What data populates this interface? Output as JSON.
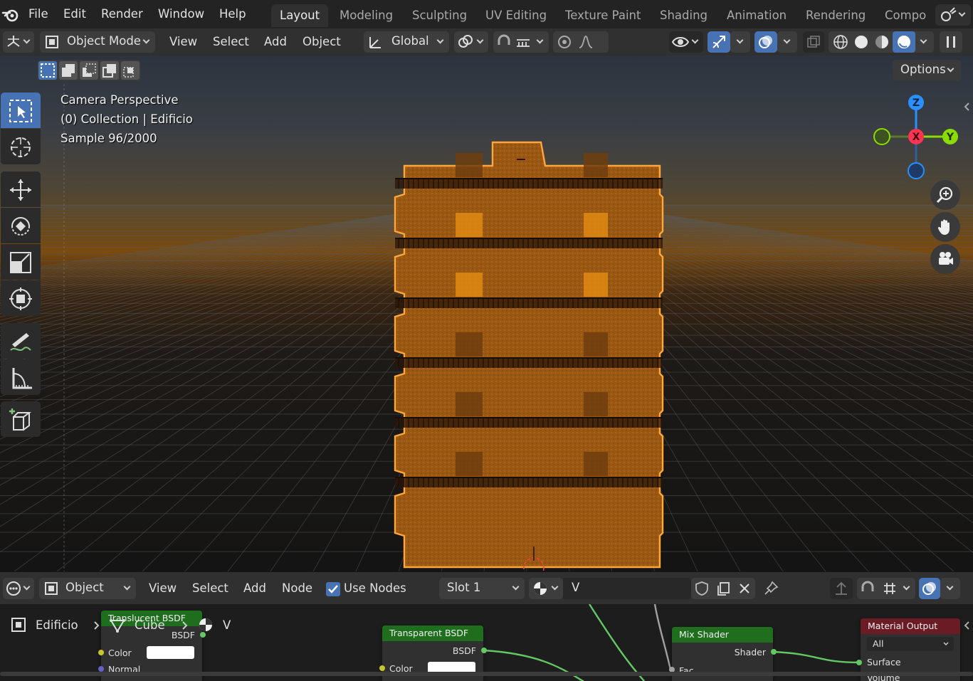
{
  "menu": {
    "items": [
      "File",
      "Edit",
      "Render",
      "Window",
      "Help"
    ]
  },
  "workspaces": {
    "tabs": [
      "Layout",
      "Modeling",
      "Sculpting",
      "UV Editing",
      "Texture Paint",
      "Shading",
      "Animation",
      "Rendering",
      "Compo"
    ],
    "active": "Layout"
  },
  "viewport_header": {
    "mode": "Object Mode",
    "menus": [
      "View",
      "Select",
      "Add",
      "Object"
    ],
    "orientation": "Global",
    "options_label": "Options"
  },
  "overlay": {
    "line1": "Camera Perspective",
    "line2": "(0) Collection | Edificio",
    "line3": "Sample 96/2000"
  },
  "gizmo": {
    "x": "X",
    "y": "Y",
    "z": "Z"
  },
  "node_header": {
    "type": "Object",
    "menus": [
      "View",
      "Select",
      "Add",
      "Node"
    ],
    "use_nodes_label": "Use Nodes",
    "use_nodes_checked": true,
    "slot": "Slot 1",
    "material_name": "V"
  },
  "breadcrumb": {
    "object": "Edificio",
    "mesh": "Cube",
    "material": "V"
  },
  "nodes": {
    "translucent": {
      "title": "Translucent BSDF",
      "output": "BSDF",
      "input_color": "Color",
      "input_normal": "Normal"
    },
    "transparent": {
      "title": "Transparent BSDF",
      "output": "BSDF",
      "input_color": "Color"
    },
    "mix": {
      "title": "Mix Shader",
      "output": "Shader",
      "input_fac": "Fac"
    },
    "output": {
      "title": "Material Output",
      "target": "All",
      "input_surface": "Surface",
      "input_volume": "Volume"
    }
  },
  "colors": {
    "accent": "#4772b3",
    "selection_outline": "#ffa63d",
    "node_shader": "#1e6e1e",
    "node_output": "#6b1b24",
    "axis_x": "#ff3352",
    "axis_y": "#8bdc00",
    "axis_z": "#2890ff"
  }
}
